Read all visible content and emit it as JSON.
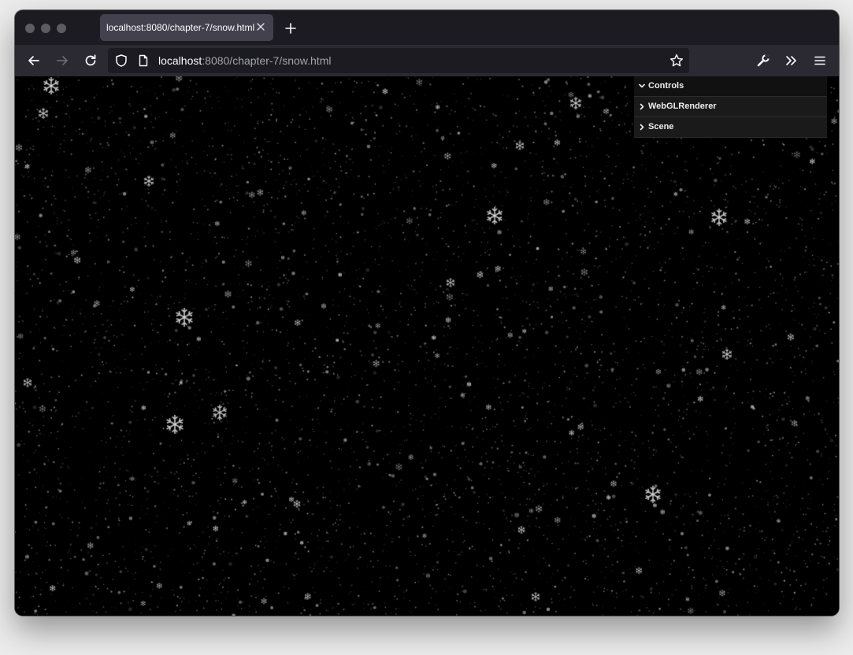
{
  "tab": {
    "title": "localhost:8080/chapter-7/snow.html"
  },
  "address_bar": {
    "host": "localhost",
    "path": ":8080/chapter-7/snow.html"
  },
  "gui": {
    "items": [
      {
        "label": "Controls",
        "expanded": true
      },
      {
        "label": "WebGLRenderer",
        "expanded": false
      },
      {
        "label": "Scene",
        "expanded": false
      }
    ]
  },
  "colors": {
    "tab_bar": "#1c1b22",
    "toolbar": "#2b2a33",
    "url_field": "#1c1b22",
    "active_tab": "#42414d",
    "canvas_background": "#000000"
  },
  "icons": {
    "tab": [
      "close-icon",
      "plus-icon"
    ],
    "toolbar": [
      "back-arrow-icon",
      "forward-arrow-icon",
      "reload-icon",
      "shield-icon",
      "page-icon",
      "star-icon",
      "wrench-icon",
      "overflow-chevrons-icon",
      "hamburger-menu-icon"
    ]
  }
}
